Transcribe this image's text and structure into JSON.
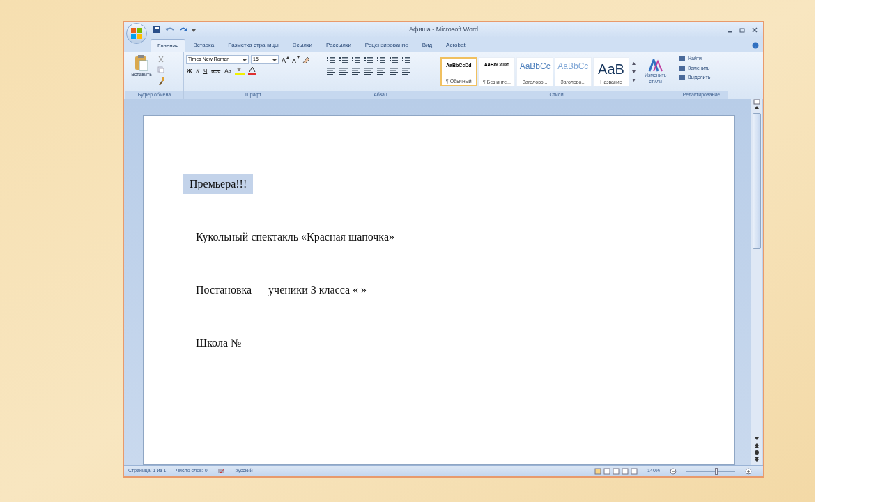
{
  "window": {
    "title": "Афиша - Microsoft Word"
  },
  "tabs": [
    {
      "label": "Главная",
      "selected": true
    },
    {
      "label": "Вставка",
      "selected": false
    },
    {
      "label": "Разметка страницы",
      "selected": false
    },
    {
      "label": "Ссылки",
      "selected": false
    },
    {
      "label": "Рассылки",
      "selected": false
    },
    {
      "label": "Рецензирование",
      "selected": false
    },
    {
      "label": "Вид",
      "selected": false
    },
    {
      "label": "Acrobat",
      "selected": false
    }
  ],
  "ribbon": {
    "clipboard": {
      "paste_label": "Вставить",
      "group": "Буфер обмена"
    },
    "font": {
      "name": "Times New Roman",
      "size": "15",
      "format_buttons": [
        "Ж",
        "К",
        "Ч",
        "abc",
        "Aa"
      ],
      "group": "Шрифт"
    },
    "paragraph": {
      "group": "Абзац"
    },
    "styles": {
      "items": [
        {
          "sample": "AaBbCcDd",
          "label": "¶ Обычный",
          "selected": true,
          "kind": "small"
        },
        {
          "sample": "AaBbCcDd",
          "label": "¶ Без инте...",
          "selected": false,
          "kind": "small"
        },
        {
          "sample": "AaBbCc",
          "label": "Заголово...",
          "selected": false,
          "kind": "heading"
        },
        {
          "sample": "AaBbCc",
          "label": "Заголово...",
          "selected": false,
          "kind": "heading2"
        },
        {
          "sample": "AaB",
          "label": "Название",
          "selected": false,
          "kind": "title"
        }
      ],
      "change_label": "Изменить стили",
      "group": "Стили"
    },
    "editing": {
      "items": [
        "Найти",
        "Заменить",
        "Выделить"
      ],
      "group": "Редактирование"
    }
  },
  "document": {
    "paragraphs": [
      {
        "text": "Премьера!!!",
        "selected": true
      },
      {
        "text": "Кукольный спектакль «Красная шапочка»",
        "selected": false
      },
      {
        "text": "Постановка — ученики 3 класса « »",
        "selected": false
      },
      {
        "text": "Школа №",
        "selected": false
      }
    ]
  },
  "status_bar": {
    "page": "Страница: 1 из 1",
    "words": "Число слов: 0",
    "language": "русский",
    "zoom": "140%",
    "zoom_slider": {
      "level": 0.62
    }
  }
}
